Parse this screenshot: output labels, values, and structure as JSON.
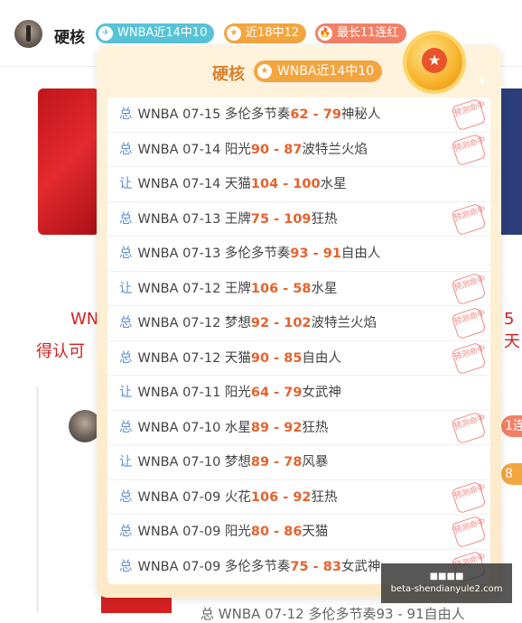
{
  "header": {
    "username": "硬核",
    "badges": [
      {
        "icon": "✈",
        "label": "WNBA近14中10"
      },
      {
        "icon": "★",
        "label": "近18中12"
      },
      {
        "icon": "🔥",
        "label": "最长11连红"
      }
    ]
  },
  "background": {
    "text1": "WN",
    "text2": "得认可",
    "text3": "5天",
    "pill1": "1连",
    "pill2": "8",
    "bottom_row": "总 WNBA 07-12 多伦多节奏93 - 91自由人"
  },
  "popup": {
    "title": "硬核",
    "badge": "WNBA近14中10",
    "medal_icon": "★",
    "stamp_text": "预测命中",
    "rows": [
      {
        "kind": "总",
        "league": "WNBA",
        "date": "07-15",
        "home": "多伦多节奏",
        "home_score": "62",
        "away_score": "79",
        "away": "神秘人",
        "hit": true
      },
      {
        "kind": "总",
        "league": "WNBA",
        "date": "07-14",
        "home": "阳光",
        "home_score": "90",
        "away_score": "87",
        "away": "波特兰火焰",
        "hit": true
      },
      {
        "kind": "让",
        "league": "WNBA",
        "date": "07-14",
        "home": "天猫",
        "home_score": "104",
        "away_score": "100",
        "away": "水星",
        "hit": false
      },
      {
        "kind": "总",
        "league": "WNBA",
        "date": "07-13",
        "home": "王牌",
        "home_score": "75",
        "away_score": "109",
        "away": "狂热",
        "hit": true
      },
      {
        "kind": "总",
        "league": "WNBA",
        "date": "07-13",
        "home": "多伦多节奏",
        "home_score": "93",
        "away_score": "91",
        "away": "自由人",
        "hit": false
      },
      {
        "kind": "让",
        "league": "WNBA",
        "date": "07-12",
        "home": "王牌",
        "home_score": "106",
        "away_score": "58",
        "away": "水星",
        "hit": true
      },
      {
        "kind": "总",
        "league": "WNBA",
        "date": "07-12",
        "home": "梦想",
        "home_score": "92",
        "away_score": "102",
        "away": "波特兰火焰",
        "hit": true
      },
      {
        "kind": "总",
        "league": "WNBA",
        "date": "07-12",
        "home": "天猫",
        "home_score": "90",
        "away_score": "85",
        "away": "自由人",
        "hit": true
      },
      {
        "kind": "让",
        "league": "WNBA",
        "date": "07-11",
        "home": "阳光",
        "home_score": "64",
        "away_score": "79",
        "away": "女武神",
        "hit": false
      },
      {
        "kind": "总",
        "league": "WNBA",
        "date": "07-10",
        "home": "水星",
        "home_score": "89",
        "away_score": "92",
        "away": "狂热",
        "hit": true
      },
      {
        "kind": "让",
        "league": "WNBA",
        "date": "07-10",
        "home": "梦想",
        "home_score": "89",
        "away_score": "78",
        "away": "风暴",
        "hit": false
      },
      {
        "kind": "总",
        "league": "WNBA",
        "date": "07-09",
        "home": "火花",
        "home_score": "106",
        "away_score": "92",
        "away": "狂热",
        "hit": true
      },
      {
        "kind": "总",
        "league": "WNBA",
        "date": "07-09",
        "home": "阳光",
        "home_score": "80",
        "away_score": "86",
        "away": "天猫",
        "hit": true
      },
      {
        "kind": "总",
        "league": "WNBA",
        "date": "07-09",
        "home": "多伦多节奏",
        "home_score": "75",
        "away_score": "83",
        "away": "女武神",
        "hit": true
      }
    ]
  },
  "watermark": {
    "line1": "■■■■",
    "line2": "beta-shendianyule2.com"
  }
}
